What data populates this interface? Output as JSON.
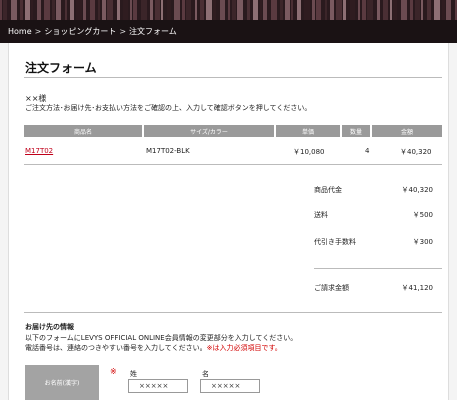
{
  "breadcrumb": {
    "home": "Home",
    "cart": "ショッピングカート",
    "current": "注文フォーム",
    "separator": ">"
  },
  "page": {
    "title": "注文フォーム",
    "customer": "××様",
    "intro": "ご注文方法･お届け先･お支払い方法をご確認の上、入力して確認ボタンを押してください。"
  },
  "table": {
    "headers": [
      "商品名",
      "サイズ/カラー",
      "単価",
      "数量",
      "金額"
    ],
    "row": {
      "product": "M17T02",
      "variant": "M17T02-BLK",
      "unit_price": "￥10,080",
      "qty": "4",
      "amount": "￥40,320"
    }
  },
  "summary": {
    "subtotal_label": "商品代金",
    "subtotal": "￥40,320",
    "shipping_label": "送料",
    "shipping": "￥500",
    "cod_label": "代引き手数料",
    "cod": "￥300",
    "total_label": "ご請求金額",
    "total": "￥41,120"
  },
  "shipping": {
    "title": "お届け先の情報",
    "line1": "以下のフォームにLEVYS OFFICIAL ONLINE会員情報の変更部分を入力してください。",
    "line2": "電話番号は、連絡のつきやすい番号を入力してください。※は入力必須項目です。",
    "line2_red": "※は入力必須項目です。",
    "name_label": "お名前(漢字)",
    "required_mark": "※",
    "sei_label": "姓",
    "mei_label": "名",
    "sei_value": "×××××",
    "mei_value": "×××××"
  },
  "colors": {
    "header_bg": "#1a1214",
    "table_header_bg": "#9a9a9a",
    "link_red": "#c0001a",
    "required_red": "#d20000"
  }
}
